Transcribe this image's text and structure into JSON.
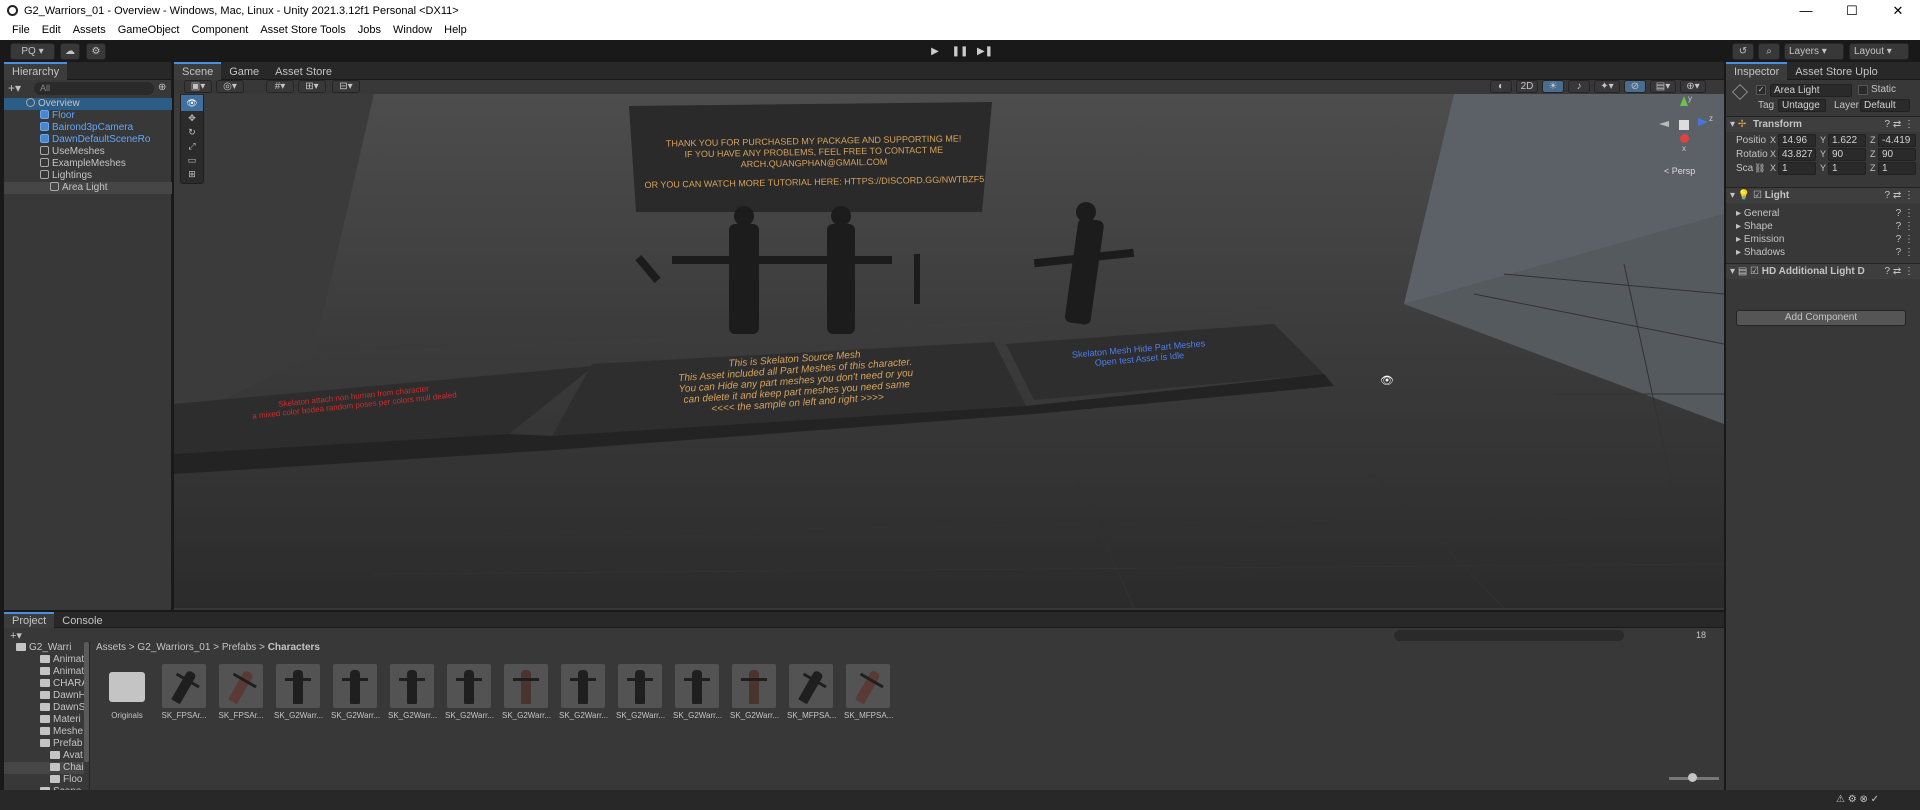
{
  "window": {
    "title": "G2_Warriors_01 - Overview - Windows, Mac, Linux - Unity 2021.3.12f1 Personal <DX11>",
    "minimize": "—",
    "maximize": "☐",
    "close": "✕"
  },
  "menu": [
    "File",
    "Edit",
    "Assets",
    "GameObject",
    "Component",
    "Asset Store Tools",
    "Jobs",
    "Window",
    "Help"
  ],
  "toolbar": {
    "account": "PQ",
    "layers": "Layers",
    "layout": "Layout",
    "play": "▶",
    "pause": "❚❚",
    "step": "▶❚"
  },
  "hierarchy": {
    "tab": "Hierarchy",
    "search_placeholder": "All",
    "items": [
      {
        "label": "Overview",
        "root": true
      },
      {
        "label": "Floor",
        "prefab": true
      },
      {
        "label": "Bairond3pCamera",
        "prefab": true
      },
      {
        "label": "DawnDefaultSceneRo",
        "prefab": true
      },
      {
        "label": "UseMeshes"
      },
      {
        "label": "ExampleMeshes"
      },
      {
        "label": "Lightings"
      },
      {
        "label": "Area Light",
        "selected": true
      }
    ]
  },
  "scene": {
    "tabs": [
      "Scene",
      "Game",
      "Asset Store"
    ],
    "toggle_2d": "2D",
    "persp_label": "< Persp",
    "gizmo_axes": {
      "x": "x",
      "y": "y",
      "z": "z"
    },
    "banner": [
      "THANK YOU FOR PURCHASED MY PACKAGE AND SUPPORTING ME!",
      "IF YOU HAVE ANY PROBLEMS, FEEL FREE TO CONTACT ME",
      "ARCH.QUANGPHAN@GMAIL.COM",
      "",
      "OR YOU CAN WATCH MORE TUTORIAL HERE: HTTPS://DISCORD.GG/NWTBZF5"
    ],
    "center_sign": [
      "This is Skelaton Source Mesh",
      "This Asset included all Part Meshes of this character.",
      "You can Hide any part meshes you don't need or you",
      "can delete it and keep part meshes you need same",
      "<<<<  the sample on left and right  >>>>"
    ],
    "right_sign": [
      "Skelaton Mesh Hide Part Meshes",
      "Open test Asset is Idle"
    ],
    "left_sign": [
      "Skelaton attach non human from character",
      "a mixed color bodea random poses per colors mull dealed"
    ]
  },
  "project": {
    "tabs": [
      "Project",
      "Console"
    ],
    "breadcrumb": [
      "Assets",
      "G2_Warriors_01",
      "Prefabs",
      "Characters"
    ],
    "count": "18",
    "folders": [
      "G2_Warri",
      "Animat",
      "Animat",
      "CHARA",
      "DawnH",
      "DawnS",
      "Materi",
      "Meshe",
      "Prefab",
      "Avat",
      "Chai",
      "Floo",
      "Scene"
    ],
    "assets": [
      "Originals",
      "SK_FPSAr...",
      "SK_FPSAr...",
      "SK_G2Warr...",
      "SK_G2Warr...",
      "SK_G2Warr...",
      "SK_G2Warr...",
      "SK_G2Warr...",
      "SK_G2Warr...",
      "SK_G2Warr...",
      "SK_G2Warr...",
      "SK_G2Warr...",
      "SK_MFPSA...",
      "SK_MFPSA..."
    ]
  },
  "inspector": {
    "tabs": [
      "Inspector",
      "Asset Store Uplo"
    ],
    "object_name": "Area Light",
    "static": "Static",
    "tag_label": "Tag",
    "tag_value": "Untagge",
    "layer_label": "Layer",
    "layer_value": "Default",
    "transform": {
      "title": "Transform",
      "position_label": "Positio",
      "rotation_label": "Rotatio",
      "scale_label": "Sca",
      "position": {
        "x": "14.96",
        "y": "1.622",
        "z": "-4.419"
      },
      "rotation": {
        "x": "43.827",
        "y": "90",
        "z": "90"
      },
      "scale": {
        "x": "1",
        "y": "1",
        "z": "1"
      }
    },
    "light": {
      "title": "Light",
      "sections": [
        "General",
        "Shape",
        "Emission",
        "Shadows"
      ]
    },
    "hd_light": "HD Additional Light D",
    "add_component": "Add Component"
  },
  "colors": {
    "accent": "#4a8fe0",
    "prefab": "#61a7f8",
    "sign_text": "#d8a35a",
    "red_text": "#d42a2a",
    "blue_text": "#4f7ef0"
  }
}
